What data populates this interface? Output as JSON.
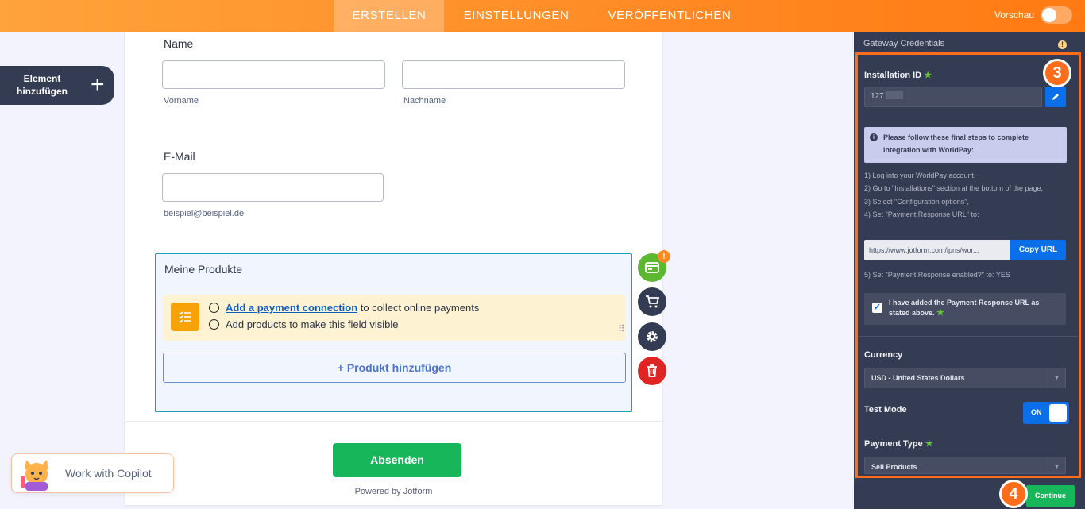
{
  "topbar": {
    "tabs": [
      {
        "label": "ERSTELLEN",
        "active": true
      },
      {
        "label": "EINSTELLUNGEN",
        "active": false
      },
      {
        "label": "VERÖFFENTLICHEN",
        "active": false
      }
    ],
    "preview_label": "Vorschau",
    "preview_on": false
  },
  "left": {
    "add_element_label": "Element hinzufügen",
    "add_element_icon": "plus-icon"
  },
  "form": {
    "name_label": "Name",
    "first_name_sublabel": "Vorname",
    "last_name_sublabel": "Nachname",
    "first_name_value": "",
    "last_name_value": "",
    "email_label": "E-Mail",
    "email_value": "",
    "email_sublabel": "beispiel@beispiel.de",
    "products": {
      "title": "Meine Produkte",
      "notice_link": "Add a payment connection",
      "notice_line1_rest": " to collect online payments",
      "notice_line2": "Add products to make this field visible",
      "add_product_label": "+ Produkt hinzufügen"
    },
    "submit_label": "Absenden",
    "powered_by": "Powered by Jotform"
  },
  "side_actions": [
    {
      "name": "payment-settings-icon",
      "color": "#5cb82f"
    },
    {
      "name": "cart-icon",
      "color": "#343c53"
    },
    {
      "name": "gear-icon",
      "color": "#343c53"
    },
    {
      "name": "trash-icon",
      "color": "#e02424"
    }
  ],
  "copilot": {
    "label": "Work with Copilot"
  },
  "panel": {
    "header": "Gateway Credentials",
    "installation_id_label": "Installation ID",
    "installation_id_value": "127",
    "info_text": "Please follow these final steps to complete integration with WorldPay:",
    "steps": [
      "1) Log into your WorldPay account,",
      "2) Go to \"Installations\" section at the bottom of the page,",
      "3) Select \"Configuration options\",",
      "4) Set \"Payment Response URL\" to:"
    ],
    "response_url": "https://www.jotform.com/ipns/wor...",
    "copy_url_label": "Copy URL",
    "step5": "5) Set \"Payment Response enabled?\" to: YES",
    "confirm_checked": true,
    "confirm_text": "I have added the Payment Response URL as stated above.",
    "currency_label": "Currency",
    "currency_value": "USD - United States Dollars",
    "test_mode_label": "Test Mode",
    "test_mode_state": "ON",
    "payment_type_label": "Payment Type",
    "payment_type_value": "Sell Products",
    "continue_label": "Continue"
  },
  "badges": {
    "step3": "3",
    "step4": "4"
  },
  "colors": {
    "accent": "#ff7a12",
    "highlight_frame": "#ff6c1a",
    "submit": "#18b65a",
    "panel_bg": "#343c53"
  }
}
